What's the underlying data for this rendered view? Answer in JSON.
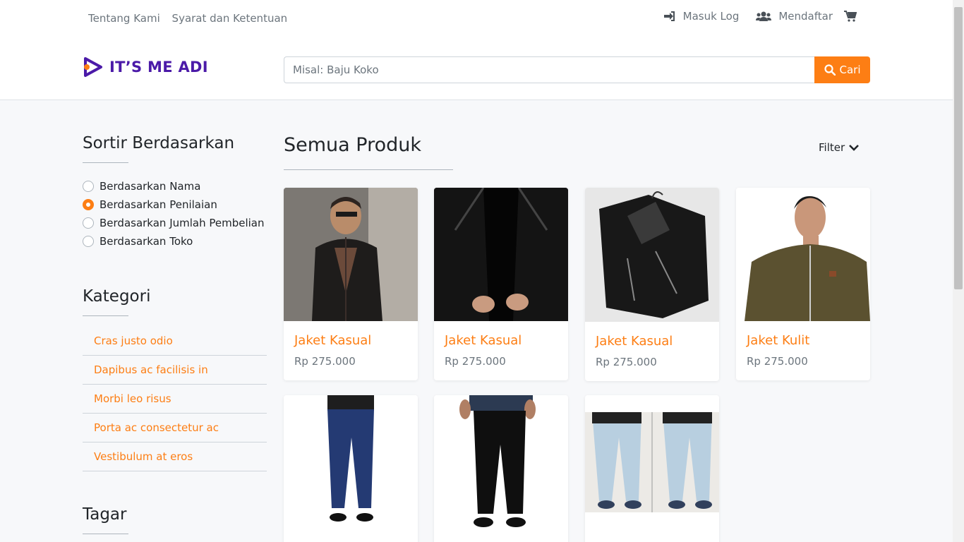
{
  "top_links": {
    "about": "Tentang Kami",
    "terms": "Syarat dan Ketentuan"
  },
  "account": {
    "login": "Masuk Log",
    "register": "Mendaftar"
  },
  "brand": {
    "name": "IT’S ME ADI",
    "color": "#4b1aa8",
    "accent": "#fd7e14"
  },
  "search": {
    "placeholder": "Misal: Baju Koko",
    "button": "Cari"
  },
  "sort": {
    "title": "Sortir Berdasarkan",
    "options": [
      "Berdasarkan Nama",
      "Berdasarkan Penilaian",
      "Berdasarkan Jumlah Pembelian",
      "Berdasarkan Toko"
    ],
    "selected": "Berdasarkan Penilaian"
  },
  "category": {
    "title": "Kategori",
    "items": [
      "Cras justo odio",
      "Dapibus ac facilisis in",
      "Morbi leo risus",
      "Porta ac consectetur ac",
      "Vestibulum at eros"
    ]
  },
  "tags": {
    "title": "Tagar"
  },
  "products": {
    "title": "Semua Produk",
    "filter_label": "Filter",
    "items": [
      {
        "name": "Jaket Kasual",
        "price": "Rp 275.000"
      },
      {
        "name": "Jaket Kasual",
        "price": "Rp 275.000"
      },
      {
        "name": "Jaket Kasual",
        "price": "Rp 275.000"
      },
      {
        "name": "Jaket Kulit",
        "price": "Rp 275.000"
      }
    ]
  }
}
